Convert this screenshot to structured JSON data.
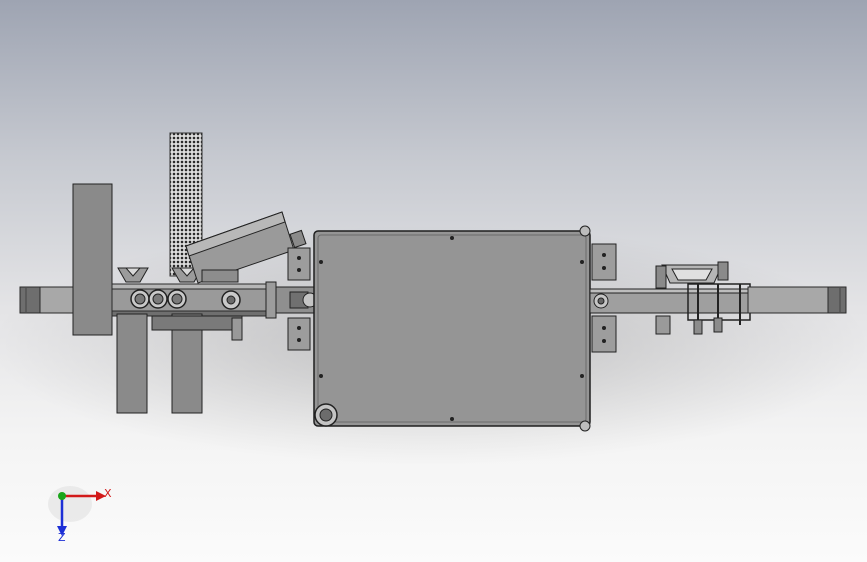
{
  "triad": {
    "x_label": "X",
    "z_label": "Z",
    "x_color": "#d21a1a",
    "z_color": "#1c2fd6",
    "y_color": "#1aa51a"
  },
  "scene": {
    "background_top": "#9ea4b2",
    "background_bottom": "#fbfbfb",
    "part_fill": "#8c8c8c",
    "part_dark": "#555555",
    "part_edge": "#2a2a2a"
  }
}
